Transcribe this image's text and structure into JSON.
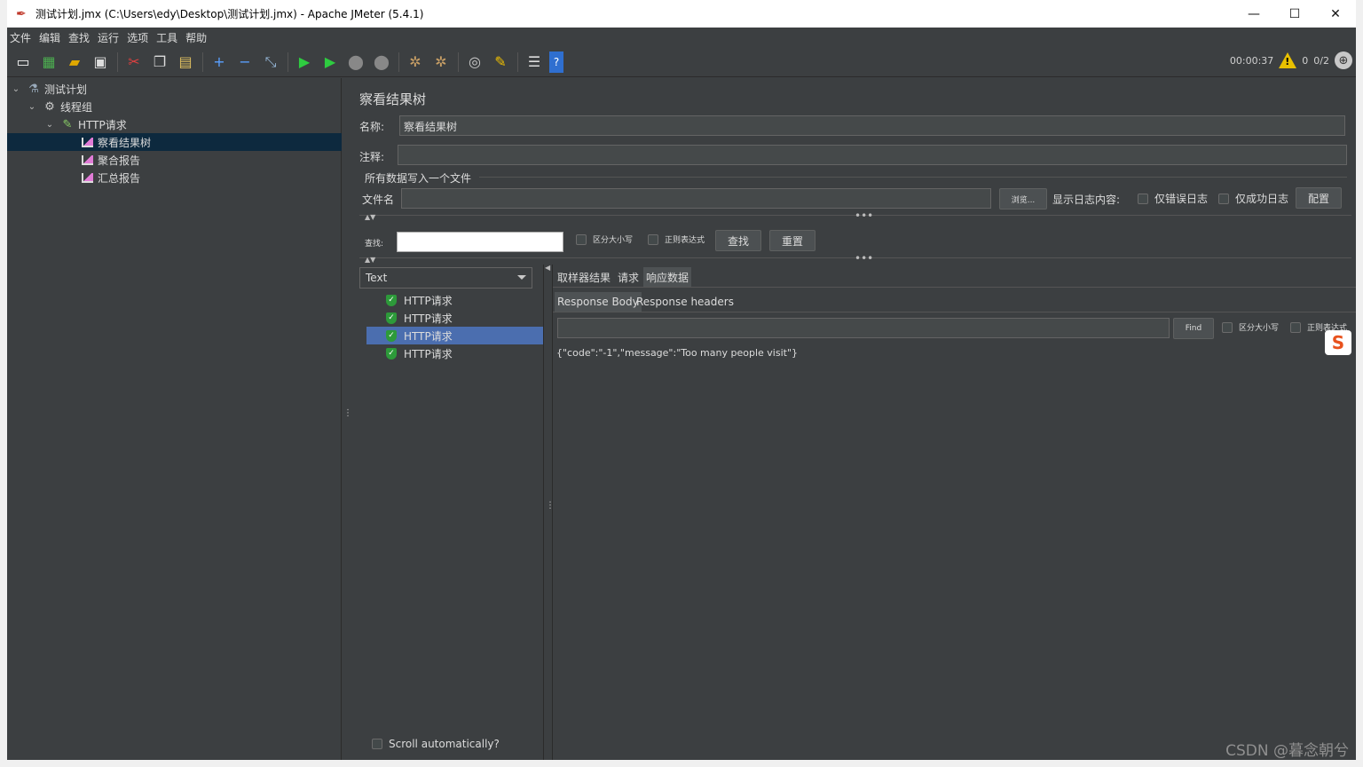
{
  "window": {
    "title": "测试计划.jmx (C:\\Users\\edy\\Desktop\\测试计划.jmx) - Apache JMeter (5.4.1)",
    "minimize": "—",
    "maximize": "☐",
    "close": "✕"
  },
  "menu": [
    "文件",
    "编辑",
    "查找",
    "运行",
    "选项",
    "工具",
    "帮助"
  ],
  "toolbar": {
    "timer": "00:00:37",
    "warnings": "0",
    "threads": "0/2"
  },
  "tree": {
    "items": [
      {
        "label": "测试计划",
        "icon": "flask-icon"
      },
      {
        "label": "线程组",
        "icon": "gear-icon"
      },
      {
        "label": "HTTP请求",
        "icon": "pipette-icon"
      },
      {
        "label": "察看结果树",
        "icon": "chart-icon"
      },
      {
        "label": "聚合报告",
        "icon": "chart-icon"
      },
      {
        "label": "汇总报告",
        "icon": "chart-icon"
      }
    ]
  },
  "panel": {
    "title": "察看结果树",
    "name_label": "名称:",
    "name_value": "察看结果树",
    "comment_label": "注释:",
    "comment_value": "",
    "file_section": "所有数据写入一个文件",
    "file_label": "文件名",
    "browse": "浏览...",
    "log_label": "显示日志内容:",
    "errors_only": "仅错误日志",
    "success_only": "仅成功日志",
    "configure": "配置",
    "search_label": "查找:",
    "case_sensitive": "区分大小写",
    "regex": "正则表达式",
    "find_btn": "查找",
    "reset_btn": "重置"
  },
  "results": {
    "renderer": "Text",
    "samples": [
      "HTTP请求",
      "HTTP请求",
      "HTTP请求",
      "HTTP请求"
    ],
    "selected_index": 2,
    "scroll_auto": "Scroll automatically?"
  },
  "detail": {
    "tabs": [
      "取样器结果",
      "请求",
      "响应数据"
    ],
    "active_tab": "响应数据",
    "subtabs": [
      "Response Body",
      "Response headers"
    ],
    "find_btn": "Find",
    "case_sensitive": "区分大小写",
    "regex": "正则表达式",
    "body": "{\"code\":\"-1\",\"message\":\"Too many people visit\"}"
  },
  "watermark": "CSDN @暮念朝兮"
}
